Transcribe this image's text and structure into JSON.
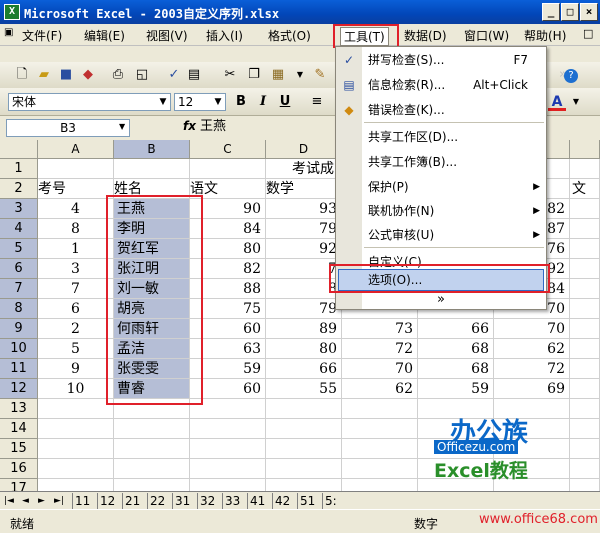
{
  "window": {
    "title": "Microsoft Excel - 2003自定义序列.xlsx",
    "minimize": "_",
    "maximize": "□",
    "close": "×",
    "icon_name": "excel-app-icon"
  },
  "menubar": {
    "items": [
      "文件(F)",
      "编辑(E)",
      "视图(V)",
      "插入(I)",
      "格式(O)",
      "工具(T)",
      "数据(D)",
      "窗口(W)",
      "帮助(H)"
    ],
    "active": "工具(T)"
  },
  "formatting": {
    "font": "宋体",
    "size": "12",
    "bold": "B",
    "italic": "I",
    "underline": "U"
  },
  "formula_bar": {
    "name_box": "B3",
    "fx": "fx",
    "value": "王燕"
  },
  "grid": {
    "columns": [
      "A",
      "B",
      "C",
      "D",
      "E",
      "F",
      "G"
    ],
    "selected_column": "B",
    "rows": [
      "1",
      "2",
      "3",
      "4",
      "5",
      "6",
      "7",
      "8",
      "9",
      "10",
      "11",
      "12",
      "13",
      "14",
      "15",
      "16",
      "17",
      "18"
    ],
    "title_cell": "考试成",
    "headers": [
      "考号",
      "姓名",
      "语文",
      "数学"
    ],
    "header_h_partial": "文",
    "data": [
      [
        "4",
        "王燕",
        "90",
        "93",
        "",
        "",
        "82"
      ],
      [
        "8",
        "李明",
        "84",
        "79",
        "",
        "",
        "87"
      ],
      [
        "1",
        "贺红军",
        "80",
        "92",
        "",
        "",
        "76"
      ],
      [
        "3",
        "张江明",
        "82",
        "7",
        "",
        "",
        "92"
      ],
      [
        "7",
        "刘一敏",
        "88",
        "8",
        "",
        "",
        "84"
      ],
      [
        "6",
        "胡亮",
        "75",
        "79",
        "",
        "",
        "70"
      ],
      [
        "2",
        "何雨轩",
        "60",
        "89",
        "73",
        "66",
        "70"
      ],
      [
        "5",
        "孟洁",
        "63",
        "80",
        "72",
        "68",
        "62"
      ],
      [
        "9",
        "张雯雯",
        "59",
        "66",
        "70",
        "68",
        "72"
      ],
      [
        "10",
        "曹睿",
        "60",
        "55",
        "62",
        "59",
        "69"
      ]
    ]
  },
  "tools_menu": {
    "items": [
      {
        "label": "拼写检查(S)...",
        "shortcut": "F7",
        "icon": "spell-check-icon"
      },
      {
        "label": "信息检索(R)...",
        "shortcut": "Alt+Click",
        "icon": "research-icon"
      },
      {
        "label": "错误检查(K)...",
        "shortcut": "",
        "icon": "error-check-icon"
      },
      {
        "label": "共享工作区(D)...",
        "shortcut": ""
      },
      {
        "label": "共享工作簿(B)...",
        "shortcut": ""
      },
      {
        "label": "保护(P)",
        "submenu": true
      },
      {
        "label": "联机协作(N)",
        "submenu": true
      },
      {
        "label": "公式审核(U)",
        "submenu": true
      },
      {
        "label": "自定义(C)...",
        "shortcut": ""
      },
      {
        "label": "选项(O)...",
        "shortcut": "",
        "highlighted": true
      }
    ],
    "expand": "»"
  },
  "sheet_tabs": {
    "nav": [
      "|◄",
      "◄",
      "►",
      "►|"
    ],
    "tabs": [
      "11",
      "12",
      "21",
      "22",
      "31",
      "32",
      "33",
      "41",
      "42",
      "51",
      "5:"
    ]
  },
  "status": {
    "left": "就绪",
    "right": "数字"
  },
  "watermark": {
    "line1": "办公族",
    "line2": "Officezu.com",
    "line3": "Excel教程",
    "url": "www.office68.com"
  },
  "accent": {
    "red_box": "#e0202a",
    "selection": "#b5bed6",
    "title_blue": "#0a5fd8"
  }
}
